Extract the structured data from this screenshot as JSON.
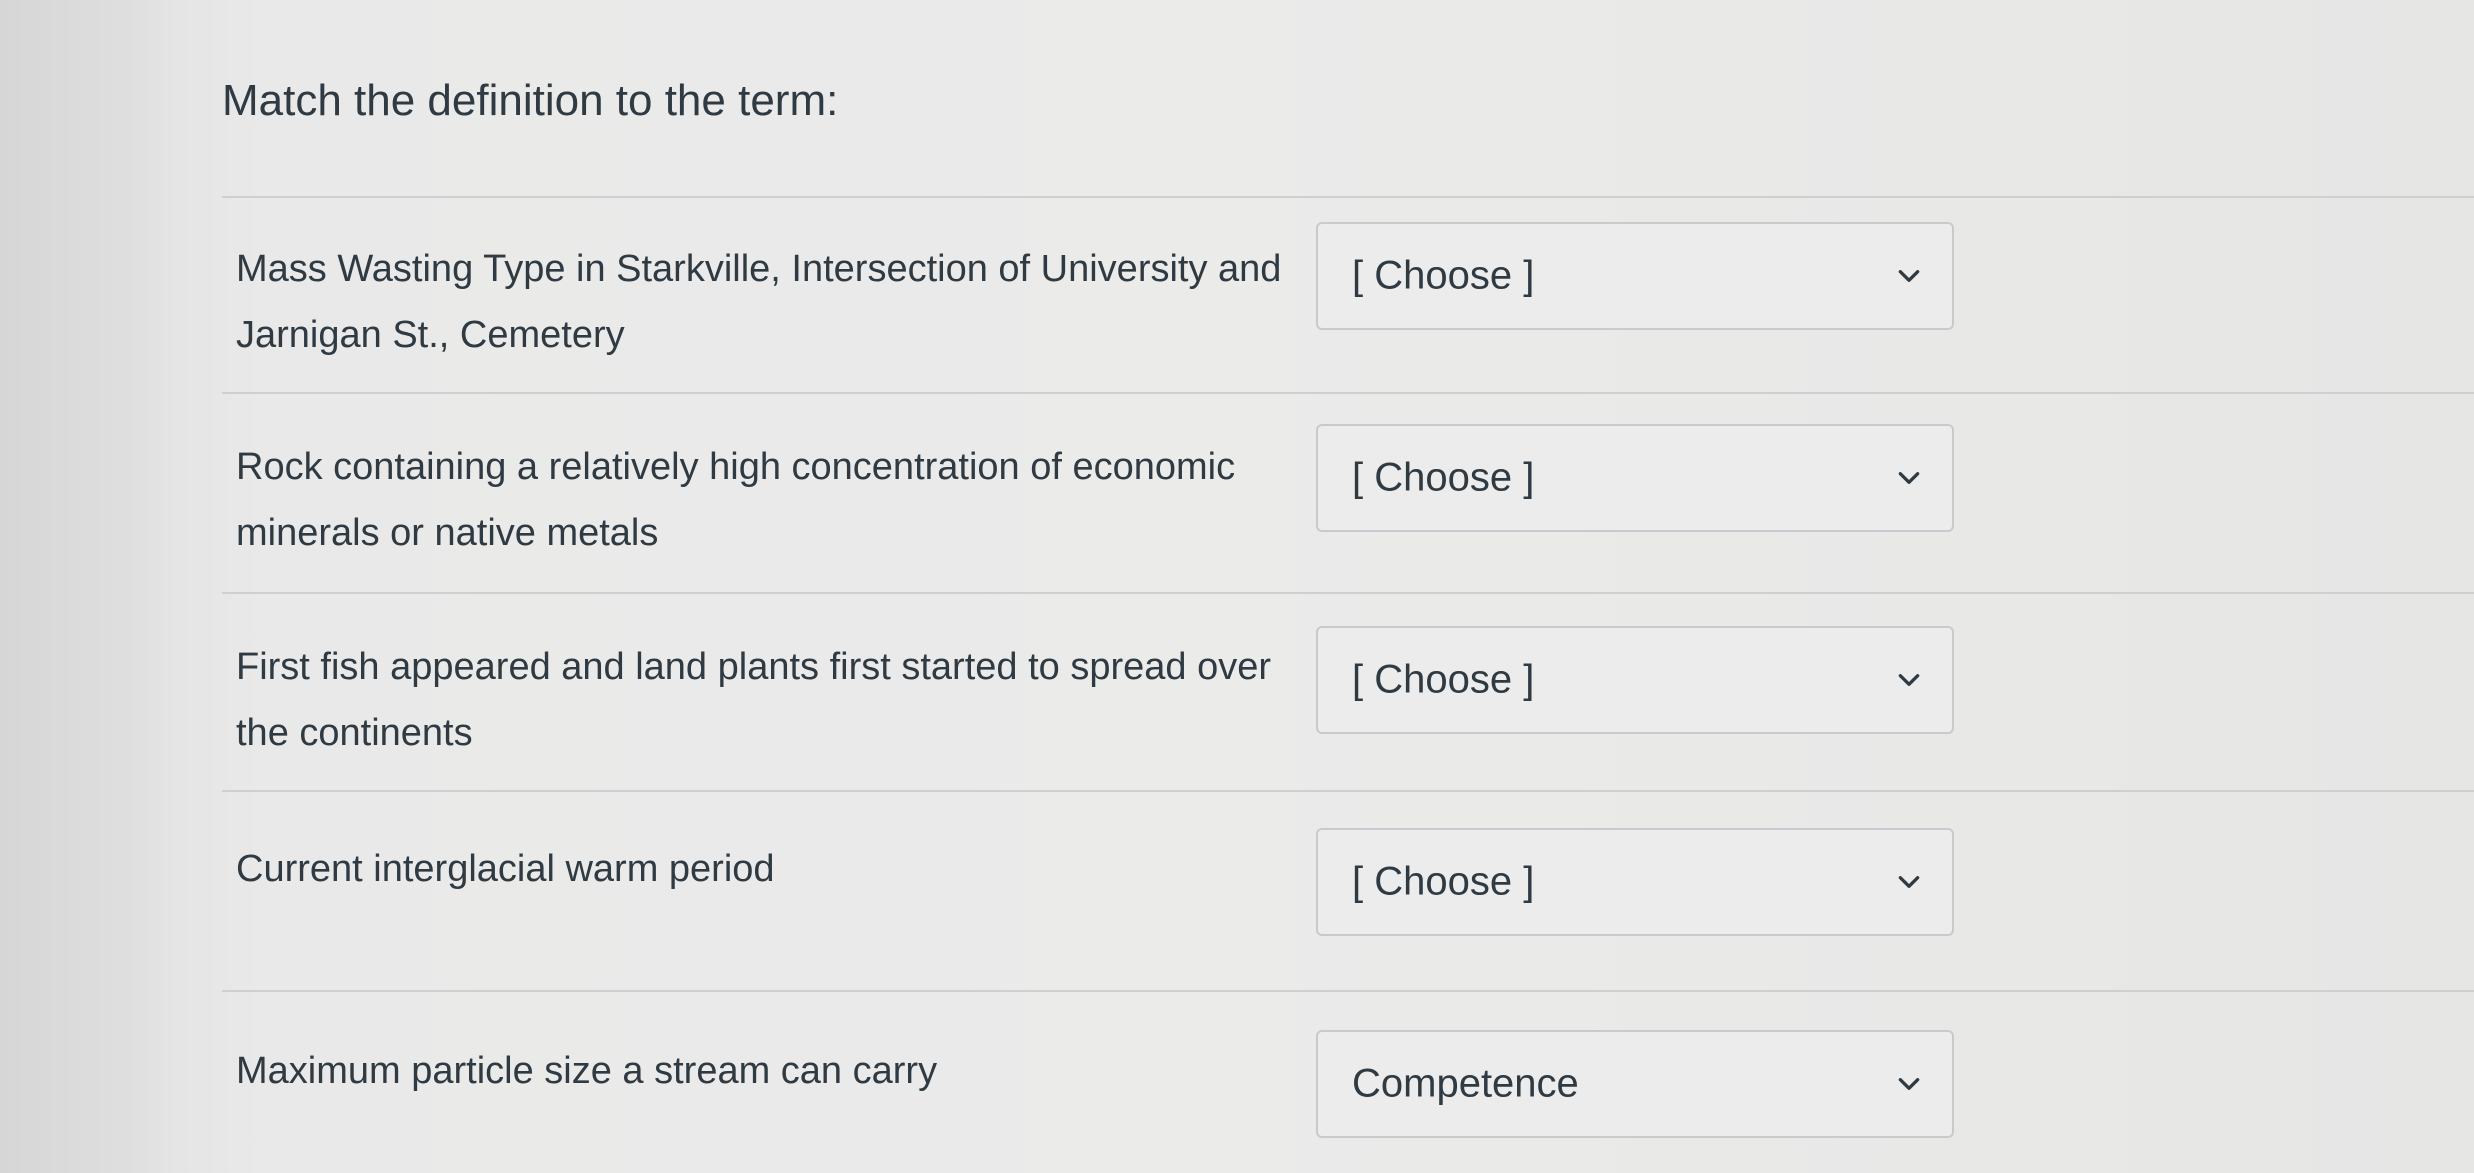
{
  "title": "Match the definition to the term:",
  "questions": [
    {
      "definition": "Mass Wasting Type in Starkville, Intersection of University and Jarnigan St., Cemetery",
      "selected": "[ Choose ]"
    },
    {
      "definition": "Rock containing a relatively high concentration of economic minerals or native metals",
      "selected": "[ Choose ]"
    },
    {
      "definition": "First fish appeared and land plants first started to spread over the continents",
      "selected": "[ Choose ]"
    },
    {
      "definition": "Current interglacial warm period",
      "selected": "[ Choose ]"
    },
    {
      "definition": "Maximum particle size a stream can carry",
      "selected": "Competence"
    }
  ],
  "icons": {
    "dropdown": "chevron-down-icon"
  }
}
